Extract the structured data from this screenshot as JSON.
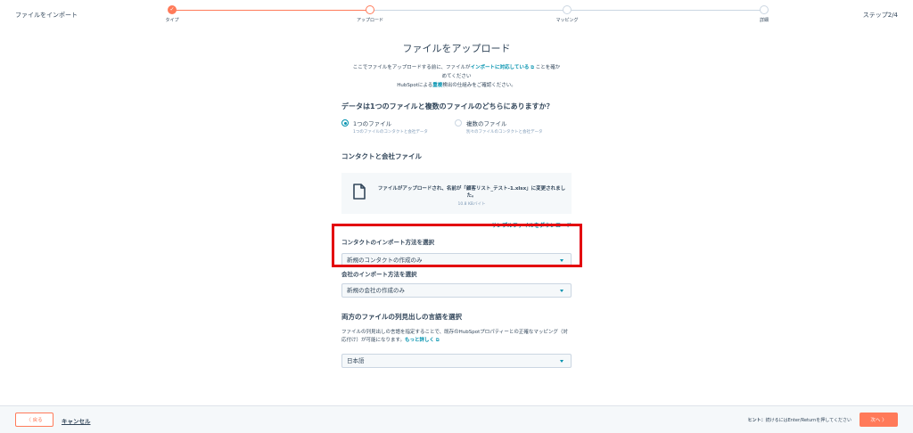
{
  "header": {
    "app_title": "ファイルをインポート",
    "step_count": "ステップ2/4",
    "steps": [
      {
        "label": "タイプ",
        "state": "done"
      },
      {
        "label": "アップロード",
        "state": "current"
      },
      {
        "label": "マッピング",
        "state": "todo"
      },
      {
        "label": "詳細",
        "state": "todo"
      }
    ]
  },
  "main": {
    "title": "ファイルをアップロード",
    "intro_part1": "ここでファイルをアップロードする前に、ファイルが",
    "intro_link": "インポートに対応している",
    "intro_part2": " ことを確かめてください",
    "intro_part3": "HubSpotによる",
    "intro_link2": "重複",
    "intro_part4": "検出の仕組みをご確認ください。",
    "question": "データは1つのファイルと複数のファイルのどちらにありますか？",
    "options": [
      {
        "label": "1つのファイル",
        "sub": "1つのファイルのコンタクトと会社データ",
        "checked": true
      },
      {
        "label": "複数のファイル",
        "sub": "別々のファイルのコンタクトと会社データ",
        "checked": false
      }
    ],
    "file_section_title": "コンタクトと会社ファイル",
    "file_message": "ファイルがアップロードされ、名前が「顧客リスト_テスト-1.xlsx」に変更されました。",
    "file_size": "10.8 KBバイト",
    "download_link": "サンプルファイルをダウンロード",
    "contact_import_label": "コンタクトのインポート方法を選択",
    "contact_import_value": "新規のコンタクトの作成のみ",
    "company_import_label": "会社のインポート方法を選択",
    "company_import_value": "新規の会社の作成のみ",
    "language_title": "両方のファイルの列見出しの言語を選択",
    "language_desc": "ファイルの列見出しの言語を指定することで、既存のHubSpotプロパティーとの正確なマッピング（対応付け）が可能になります。",
    "language_link": "もっと詳しく",
    "language_value": "日本語"
  },
  "footer": {
    "back_label": "〈 戻る",
    "cancel_label": "キャンセル",
    "hint_bold": "ヒント：",
    "hint_text": "続けるにはEnter/Returnを押してください",
    "next_label": "次へ 〉"
  },
  "colors": {
    "accent": "#ff7a59",
    "link": "#0091ae",
    "highlight": "#e3000f",
    "text": "#33475b"
  }
}
